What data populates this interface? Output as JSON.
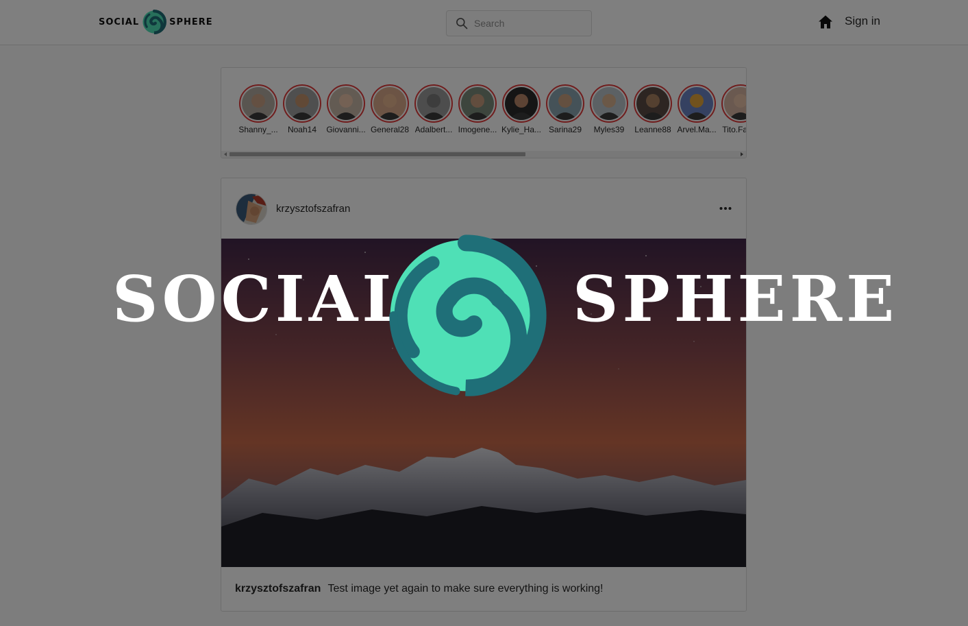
{
  "header": {
    "brand_left": "SOCIAL",
    "brand_right": "SPHERE",
    "logo_icon": "social-sphere-swirl-logo",
    "search_placeholder": "Search",
    "home_icon": "home-icon",
    "signin_label": "Sign in"
  },
  "stories": {
    "items": [
      {
        "name": "Shanny_...",
        "skin": "#c9a184",
        "bg": "#b2aaa0"
      },
      {
        "name": "Noah14",
        "skin": "#c2926d",
        "bg": "#9e9e9e"
      },
      {
        "name": "Giovanni...",
        "skin": "#e8c2a8",
        "bg": "#c7b7a7"
      },
      {
        "name": "General28",
        "skin": "#e4b48f",
        "bg": "#d9a88a"
      },
      {
        "name": "Adalbert...",
        "skin": "#7a7a7a",
        "bg": "#9a9a9a"
      },
      {
        "name": "Imogene...",
        "skin": "#c59b7c",
        "bg": "#7b8a7a"
      },
      {
        "name": "Kylie_Ha...",
        "skin": "#b98668",
        "bg": "#2a2a2a"
      },
      {
        "name": "Sarina29",
        "skin": "#c9a080",
        "bg": "#8aa4b0"
      },
      {
        "name": "Myles39",
        "skin": "#d6b08e",
        "bg": "#b8c2c8"
      },
      {
        "name": "Leanne88",
        "skin": "#a88060",
        "bg": "#5a4a44"
      },
      {
        "name": "Arvel.Ma...",
        "skin": "#e3a53a",
        "bg": "#6a82c2"
      },
      {
        "name": "Tito.Fah...",
        "skin": "#e6c0a6",
        "bg": "#d4b2a0"
      }
    ]
  },
  "post": {
    "username": "krzysztofszafran",
    "more_icon": "more-options-icon",
    "image_subject": "snowy-mountain-range-starry-sky",
    "caption_user": "krzysztofszafran",
    "caption_text": "Test image yet again to make sure everything is working!"
  },
  "overlay": {
    "word_left": "SOCIAL",
    "word_right": "SPHERE",
    "logo_icon": "social-sphere-swirl-logo",
    "colors": {
      "teal_dark": "#1f6f78",
      "teal_light": "#4fe0b6"
    }
  },
  "colors": {
    "story_ring": "#e03b3b",
    "border": "#dbdbdb",
    "page_bg": "#fafafa"
  }
}
